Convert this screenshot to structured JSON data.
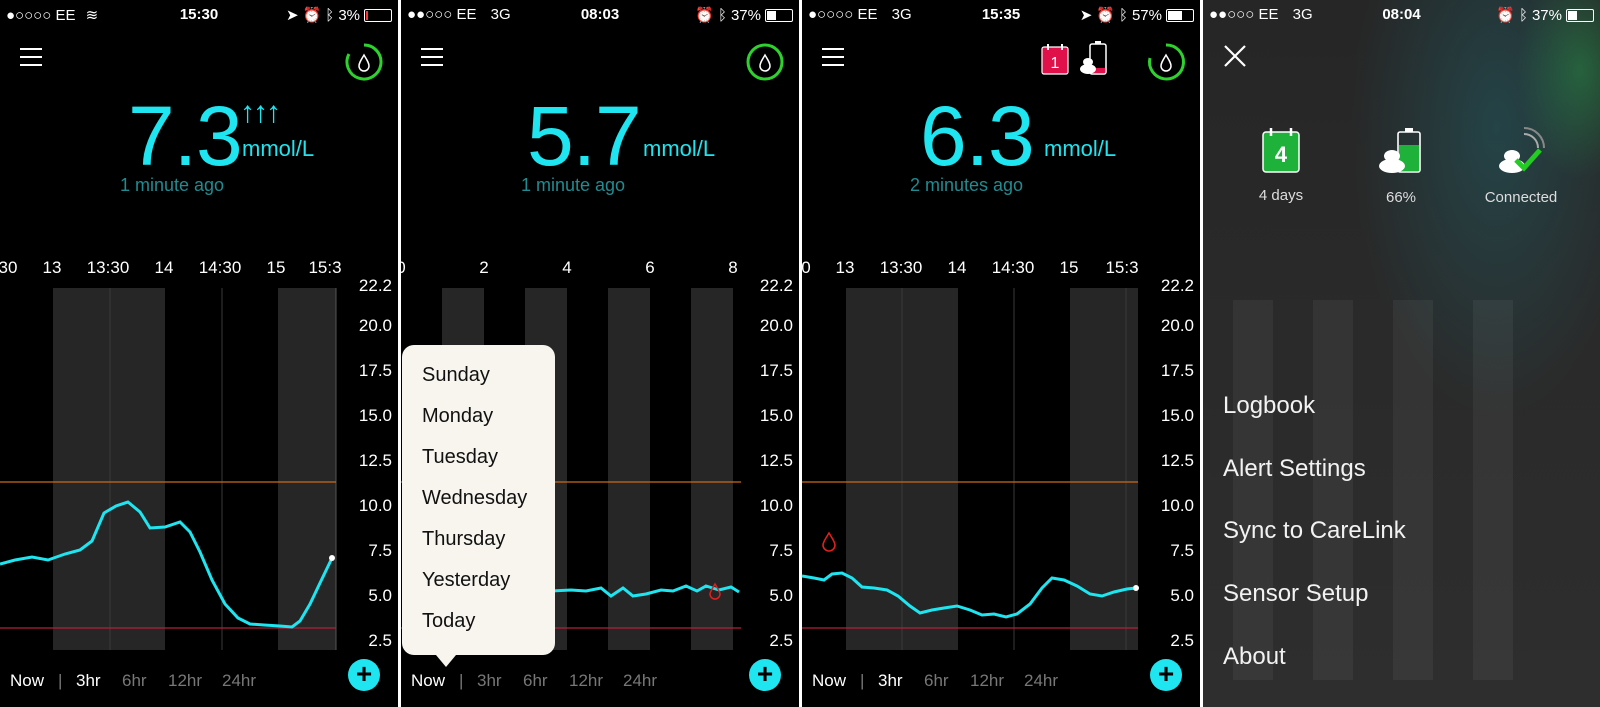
{
  "colors": {
    "accent": "#1ee5ef",
    "high_line": "#c86a1a",
    "low_line": "#b0203a",
    "ring": "#2ed12e",
    "bg": "#000000"
  },
  "screens": [
    {
      "status": {
        "carrier": "●○○○○ EE",
        "net": "wifi",
        "time": "15:30",
        "battery": "3%"
      },
      "reading": {
        "value": "7.3",
        "unit": "mmol/L",
        "ago": "1 minute ago",
        "arrows": "↑↑↑"
      },
      "ticks": [
        "30",
        "13",
        "13:30",
        "14",
        "14:30",
        "15",
        "15:3"
      ],
      "yaxis": [
        "22.2",
        "20.0",
        "17.5",
        "15.0",
        "12.5",
        "10.0",
        "7.5",
        "5.0",
        "2.5"
      ],
      "ranges": [
        "Now",
        "|",
        "3hr",
        "6hr",
        "12hr",
        "24hr"
      ]
    },
    {
      "status": {
        "carrier": "●●○○○ EE",
        "net": "3G",
        "time": "08:03",
        "battery": "37%"
      },
      "reading": {
        "value": "5.7",
        "unit": "mmol/L",
        "ago": "1 minute ago"
      },
      "ticks": [
        "0",
        "2",
        "4",
        "6",
        "8"
      ],
      "yaxis": [
        "22.2",
        "20.0",
        "17.5",
        "15.0",
        "12.5",
        "10.0",
        "7.5",
        "5.0",
        "2.5"
      ],
      "ranges": [
        "Now",
        "|",
        "3hr",
        "6hr",
        "12hr",
        "24hr"
      ],
      "popup": [
        "Sunday",
        "Monday",
        "Tuesday",
        "Wednesday",
        "Thursday",
        "Yesterday",
        "Today"
      ]
    },
    {
      "status": {
        "carrier": "●○○○○ EE",
        "net": "3G",
        "time": "15:35",
        "battery": "57%"
      },
      "reading": {
        "value": "6.3",
        "unit": "mmol/L",
        "ago": "2 minutes ago"
      },
      "calendar_badge": "1",
      "ticks": [
        "0",
        "13",
        "13:30",
        "14",
        "14:30",
        "15",
        "15:3"
      ],
      "yaxis": [
        "22.2",
        "20.0",
        "17.5",
        "15.0",
        "12.5",
        "10.0",
        "7.5",
        "5.0",
        "2.5"
      ],
      "ranges": [
        "Now",
        "|",
        "3hr",
        "6hr",
        "12hr",
        "24hr"
      ]
    },
    {
      "status": {
        "carrier": "●●○○○ EE",
        "net": "3G",
        "time": "08:04",
        "battery": "37%"
      },
      "sensor_days": "4",
      "icons": [
        {
          "icon": "calendar-icon",
          "caption": "4 days"
        },
        {
          "icon": "transmitter-battery-icon",
          "caption": "66%"
        },
        {
          "icon": "connected-icon",
          "caption": "Connected"
        }
      ],
      "menu": [
        "Logbook",
        "Alert Settings",
        "Sync to CareLink",
        "Sensor Setup",
        "About"
      ]
    }
  ]
}
